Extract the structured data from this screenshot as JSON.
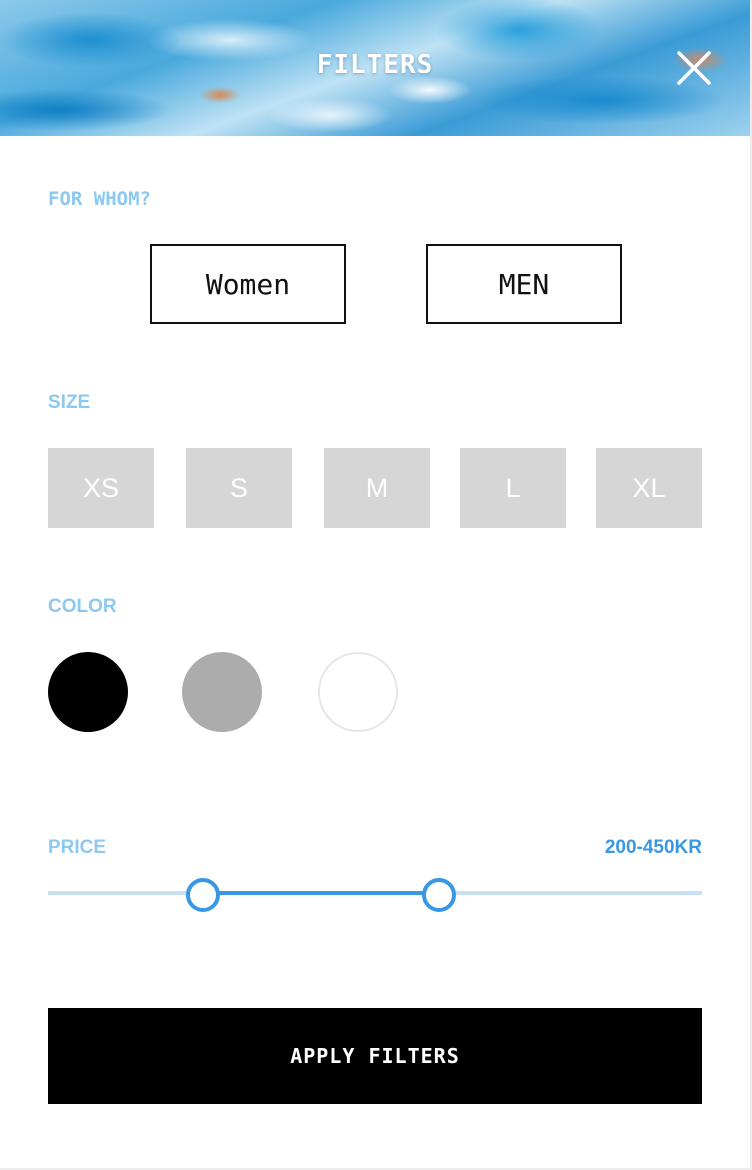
{
  "header": {
    "title": "FILTERS",
    "close_icon": "close-icon"
  },
  "for_whom": {
    "label": "FOR WHOM?",
    "options": [
      "Women",
      "MEN"
    ]
  },
  "size": {
    "label": "SIZE",
    "options": [
      "XS",
      "S",
      "M",
      "L",
      "XL"
    ]
  },
  "color": {
    "label": "COLOR",
    "swatches": [
      {
        "name": "black",
        "hex": "#000000"
      },
      {
        "name": "gray",
        "hex": "#acacac"
      },
      {
        "name": "white",
        "hex": "#ffffff"
      }
    ]
  },
  "price": {
    "label": "PRICE",
    "value": "200-450KR"
  },
  "apply_label": "APPLY FILTERS",
  "colors": {
    "accent": "#3a97e3",
    "label": "#8cc8ef",
    "size_bg": "#d6d6d6"
  }
}
